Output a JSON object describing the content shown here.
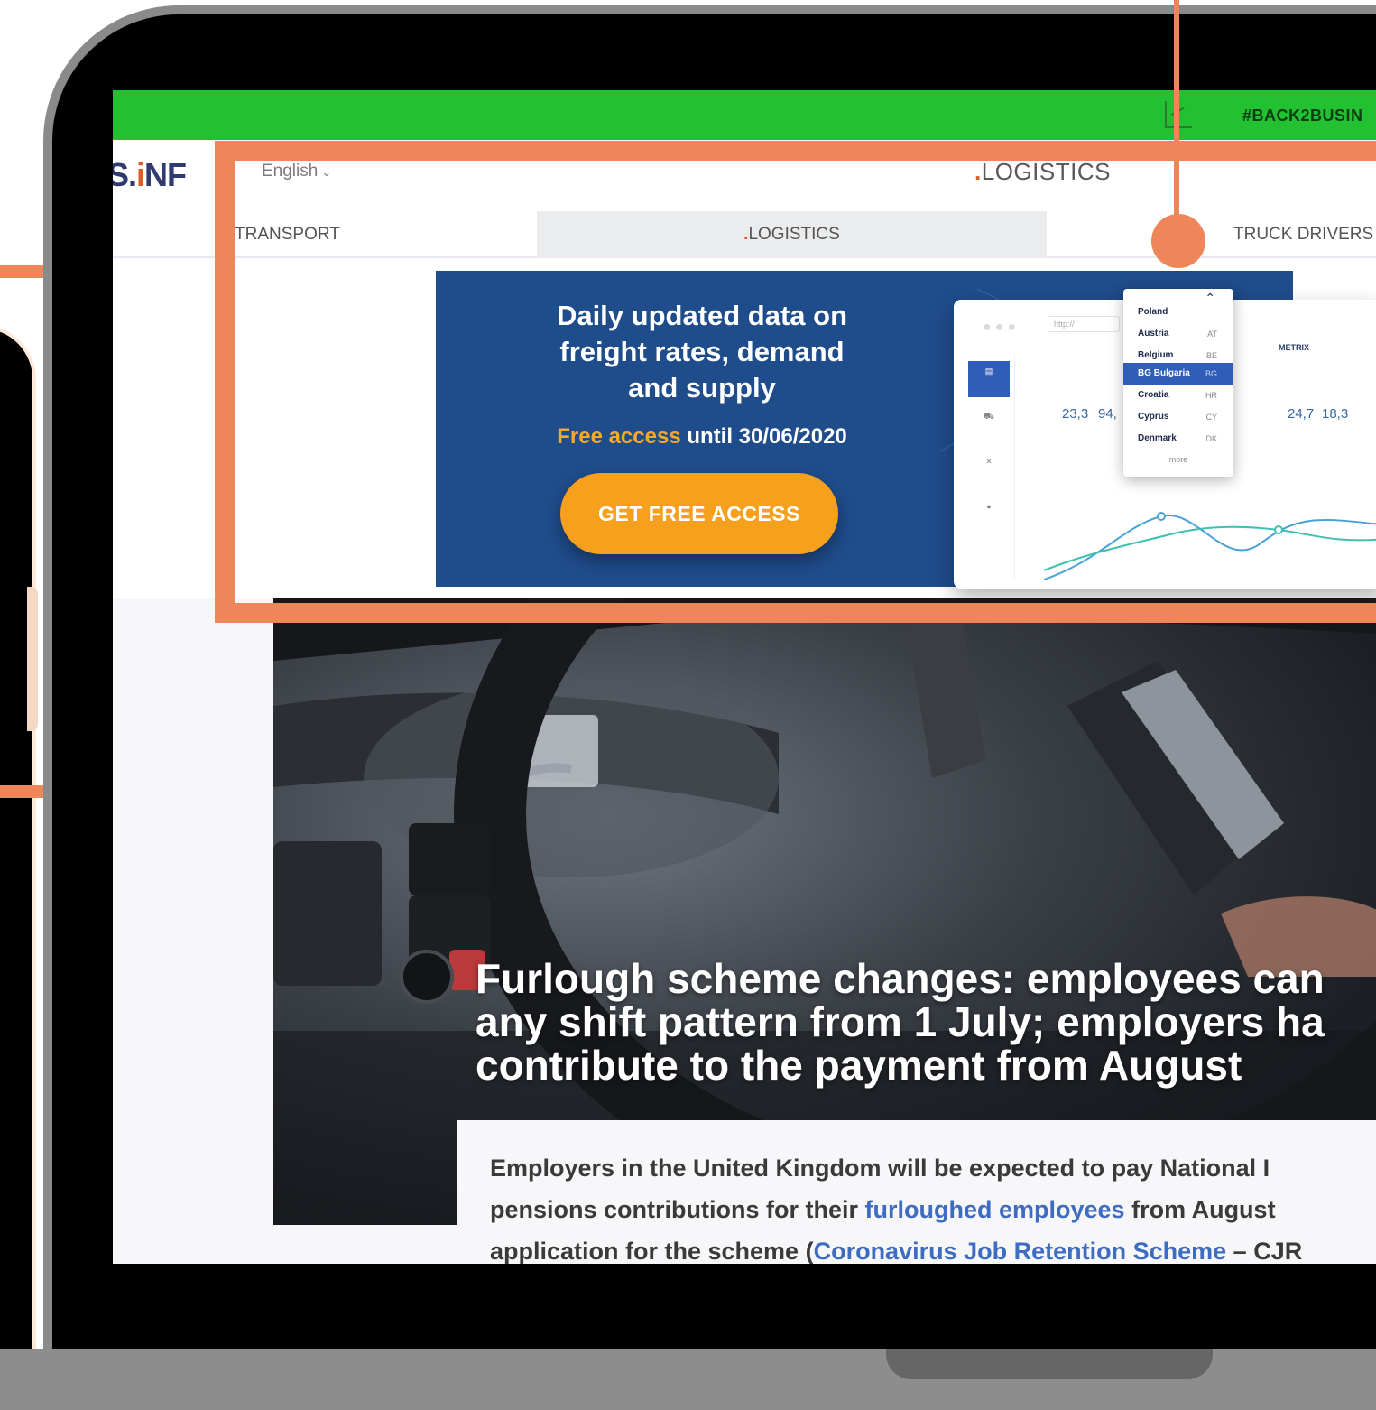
{
  "strip": {
    "tag": "#BACK2BUSIN"
  },
  "header": {
    "brand_prefix": "S.",
    "brand_accent": "i",
    "brand_suffix": "NF",
    "language": "English",
    "section_dot": ".",
    "section": "LOGISTICS"
  },
  "nav": {
    "tabs": [
      {
        "label": "TRANSPORT"
      },
      {
        "dot": ".",
        "label": "LOGISTICS"
      },
      {
        "label": "TRUCK DRIVERS"
      }
    ]
  },
  "banner": {
    "headline_line1": "Daily updated data on",
    "headline_line2": "freight rates, demand",
    "headline_line3": "and supply",
    "sub_highlight": "Free access",
    "sub_rest": " until 30/06/2020",
    "cta_label": "GET FREE ACCESS",
    "app": {
      "url": "http://",
      "logo": "METRIX",
      "values": [
        "23,3",
        "94,",
        "24,7",
        "18,3"
      ]
    },
    "countries": {
      "items": [
        {
          "name": "Poland",
          "code": ""
        },
        {
          "name": "Austria",
          "code": "AT"
        },
        {
          "name": "Belgium",
          "code": "BE"
        },
        {
          "name": "BG Bulgaria",
          "code": "BG"
        },
        {
          "name": "Croatia",
          "code": "HR"
        },
        {
          "name": "Cyprus",
          "code": "CY"
        },
        {
          "name": "Denmark",
          "code": "DK"
        }
      ],
      "selected": "BG Bulgaria",
      "more": "more"
    }
  },
  "article": {
    "title": "Furlough scheme changes: employees can\nany shift pattern from 1 July; employers ha\ncontribute to the payment from August",
    "lead_line1": "Employers in the United Kingdom will be expected to pay National I",
    "lead_line2_pre": "pensions contributions for their ",
    "lead_line2_link": "furloughed employees",
    "lead_line2_post": " from August",
    "lead_line3_pre": "application for the scheme (",
    "lead_line3_link": "Coronavirus Job Retention Scheme",
    "lead_line3_post": " – CJR"
  },
  "colors": {
    "strip_green": "#21c132",
    "callout_orange": "#ee8659",
    "banner_blue": "#1f4c8b",
    "cta_orange": "#f6a01e",
    "link_blue": "#3d6cc0"
  }
}
